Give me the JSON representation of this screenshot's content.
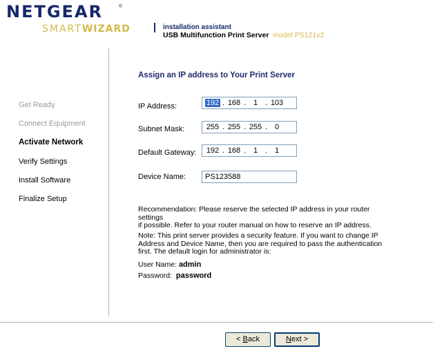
{
  "header": {
    "logo_top": "NETGEAR",
    "logo_reg": "®",
    "logo_bottom_light": "SMART",
    "logo_bottom_bold": "WIZARD",
    "assistant_label": "installation assistant",
    "product": "USB Multifunction Print Server",
    "model": "model PS121v2"
  },
  "sidebar": {
    "items": [
      {
        "label": "Get Ready",
        "state": "done"
      },
      {
        "label": "Connect Equipment",
        "state": "done"
      },
      {
        "label": "Activate Network",
        "state": "active"
      },
      {
        "label": "Verify Settings",
        "state": "pending"
      },
      {
        "label": "Install Software",
        "state": "pending"
      },
      {
        "label": "Finalize Setup",
        "state": "pending"
      }
    ]
  },
  "main": {
    "heading": "Assign an IP address to Your Print Server",
    "ip_address": {
      "label": "IP Address:",
      "octets": [
        "192",
        "168",
        "1",
        "103"
      ]
    },
    "subnet_mask": {
      "label": "Subnet Mask:",
      "octets": [
        "255",
        "255",
        "255",
        "0"
      ]
    },
    "default_gateway": {
      "label": "Default Gateway:",
      "octets": [
        "192",
        "168",
        "1",
        "1"
      ]
    },
    "device_name": {
      "label": "Device Name:",
      "value": "PS123588"
    },
    "separator": ".",
    "recommendation_1": "Recommendation: Please reserve the selected IP address in your router settings",
    "recommendation_2": "if possible. Refer to your router manual on how to reserve an IP address.",
    "note_1": "Note: This print server provides a security feature. If you want to change IP",
    "note_2": "Address and Device Name, then you are required to pass the authentication",
    "note_3": "first. The default login for administrator is:",
    "username_label": "User Name:",
    "username_value": "admin",
    "password_label": "Password:",
    "password_value": "password"
  },
  "footer": {
    "back_prefix": "< ",
    "back_key": "B",
    "back_rest": "ack",
    "next_key": "N",
    "next_rest": "ext >"
  },
  "colors": {
    "brand_navy": "#17296a",
    "brand_gold": "#d3b94b",
    "selection": "#316ac5"
  }
}
